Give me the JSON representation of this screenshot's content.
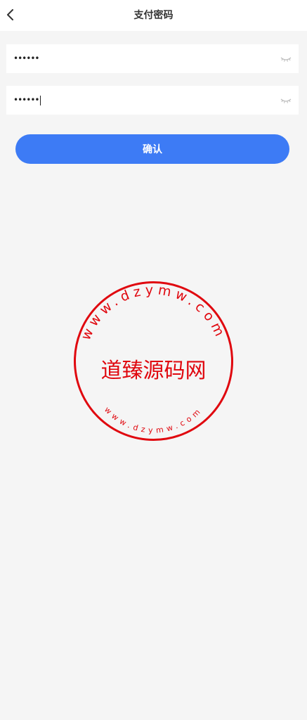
{
  "header": {
    "title": "支付密码",
    "back_icon": "chevron-left-icon"
  },
  "form": {
    "password_value": "••••••",
    "confirm_password_value": "••••••",
    "eye_icon": "eye-closed-icon"
  },
  "confirm_button": {
    "label": "确认"
  },
  "watermark": {
    "center_text": "道臻源码网",
    "top_arc_text": "www.dzymw.com",
    "bottom_arc_text": "www.dzymw.com",
    "color": "#e0080f"
  },
  "colors": {
    "accent": "#3d7bf5",
    "background": "#f5f5f5",
    "surface": "#ffffff",
    "title_text": "#333333",
    "seal": "#e0080f"
  }
}
